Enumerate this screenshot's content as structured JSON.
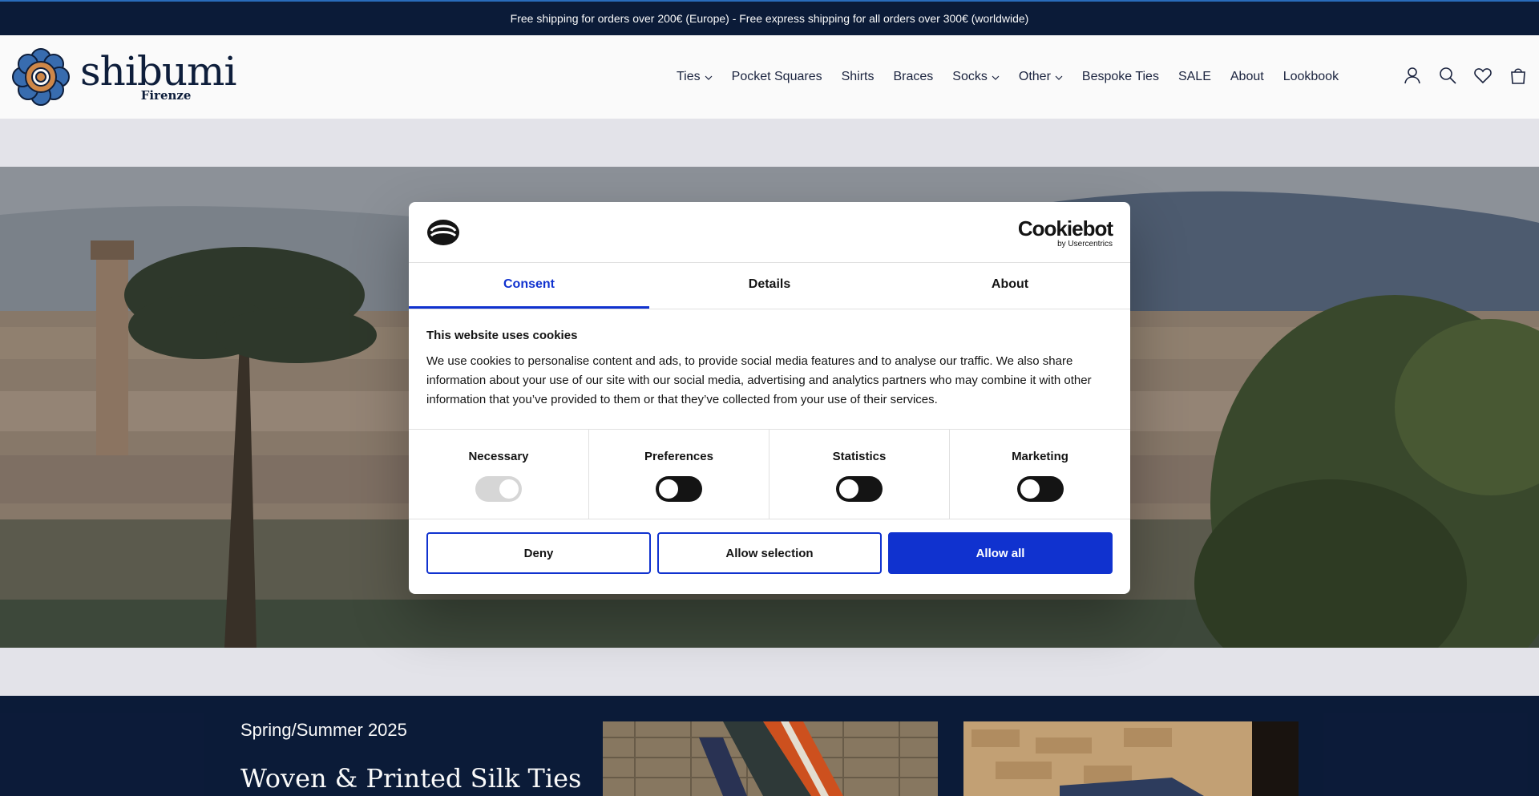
{
  "announcement": "Free shipping for orders over 200€ (Europe) - Free express shipping for all orders over 300€ (worldwide)",
  "brand": {
    "name": "shibumi",
    "sub": "Firenze"
  },
  "nav": [
    {
      "label": "Ties",
      "dropdown": true
    },
    {
      "label": "Pocket Squares",
      "dropdown": false
    },
    {
      "label": "Shirts",
      "dropdown": false
    },
    {
      "label": "Braces",
      "dropdown": false
    },
    {
      "label": "Socks",
      "dropdown": true
    },
    {
      "label": "Other",
      "dropdown": true
    },
    {
      "label": "Bespoke Ties",
      "dropdown": false
    },
    {
      "label": "SALE",
      "dropdown": false
    },
    {
      "label": "About",
      "dropdown": false
    },
    {
      "label": "Lookbook",
      "dropdown": false
    }
  ],
  "header_icons": [
    "account-icon",
    "search-icon",
    "heart-icon",
    "bag-icon"
  ],
  "section": {
    "season": "Spring/Summer 2025",
    "collection": "Woven & Printed Silk Ties"
  },
  "cookie": {
    "brand": "Cookiebot",
    "brand_sub": "by Usercentrics",
    "tabs": [
      "Consent",
      "Details",
      "About"
    ],
    "active_tab": "Consent",
    "title": "This website uses cookies",
    "text": "We use cookies to personalise content and ads, to provide social media features and to analyse our traffic. We also share information about your use of our site with our social media, advertising and analytics partners who may combine it with other information that you’ve provided to them or that they’ve collected from your use of their services.",
    "toggles": [
      {
        "label": "Necessary",
        "state": "on-disabled"
      },
      {
        "label": "Preferences",
        "state": "off"
      },
      {
        "label": "Statistics",
        "state": "off"
      },
      {
        "label": "Marketing",
        "state": "off"
      }
    ],
    "buttons": {
      "deny": "Deny",
      "allow_selection": "Allow selection",
      "allow_all": "Allow all"
    }
  },
  "colors": {
    "navy": "#0c1c3a",
    "cookie_blue": "#1032cf",
    "text": "#141414"
  }
}
